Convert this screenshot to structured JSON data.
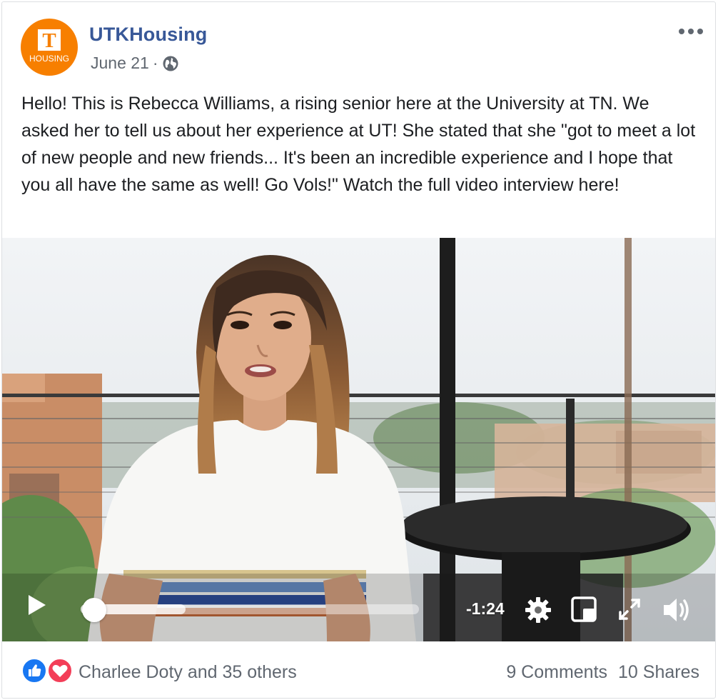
{
  "post": {
    "page_name": "UTKHousing",
    "date": "June 21",
    "separator": "·",
    "privacy_icon": "globe-icon",
    "more_icon": "ellipsis-icon",
    "avatar": {
      "logo_letter": "T",
      "logo_text": "HOUSING",
      "color": "#f77f00"
    },
    "text": "Hello! This is Rebecca Williams, a rising senior here at the University at TN. We asked her to tell us about her experience at UT! She stated that she \"got to meet a lot of new people and new friends... It's been an incredible experience and I hope that you all have the same as well! Go Vols!\" Watch the full video interview here!"
  },
  "video": {
    "remaining_time": "-1:24",
    "progress_fraction": 0.04,
    "buffered_fraction": 0.31,
    "controls": [
      "play-icon",
      "gear-icon",
      "pip-icon",
      "fullscreen-icon",
      "volume-icon"
    ]
  },
  "footer": {
    "reaction_icons": [
      "like-icon",
      "love-icon"
    ],
    "reaction_names": "Charlee Doty and 35 others",
    "comments": "9 Comments",
    "shares": "10 Shares"
  },
  "colors": {
    "link": "#385898",
    "secondary_text": "#606770",
    "like_blue": "#1877f2",
    "love_red": "#f33e58"
  }
}
